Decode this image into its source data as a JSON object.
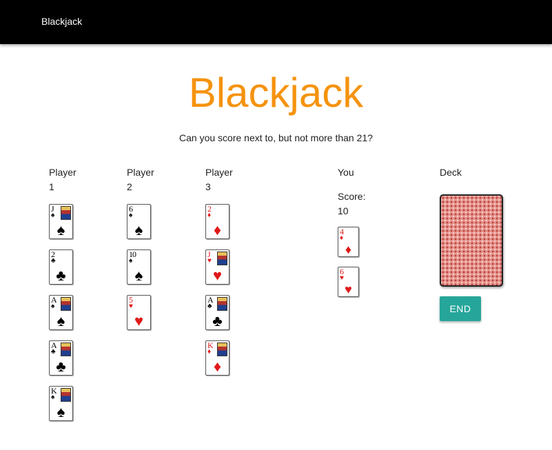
{
  "appbar": {
    "title": "Blackjack"
  },
  "header": {
    "title": "Blackjack",
    "subtitle": "Can you score next to, but not more than 21?"
  },
  "players": [
    {
      "label_line1": "Player",
      "label_line2": "1",
      "cards": [
        {
          "rank": "J",
          "suit": "♠",
          "color": "black",
          "face": true
        },
        {
          "rank": "2",
          "suit": "♣",
          "color": "black",
          "face": false
        },
        {
          "rank": "A",
          "suit": "♠",
          "color": "black",
          "face": true
        },
        {
          "rank": "A",
          "suit": "♣",
          "color": "black",
          "face": true
        },
        {
          "rank": "K",
          "suit": "♠",
          "color": "black",
          "face": true
        }
      ]
    },
    {
      "label_line1": "Player",
      "label_line2": "2",
      "cards": [
        {
          "rank": "6",
          "suit": "♠",
          "color": "black",
          "face": false
        },
        {
          "rank": "10",
          "suit": "♠",
          "color": "black",
          "face": false
        },
        {
          "rank": "5",
          "suit": "♥",
          "color": "red",
          "face": false
        }
      ]
    },
    {
      "label_line1": "Player",
      "label_line2": "3",
      "cards": [
        {
          "rank": "2",
          "suit": "♦",
          "color": "red",
          "face": false
        },
        {
          "rank": "J",
          "suit": "♥",
          "color": "red",
          "face": true
        },
        {
          "rank": "A",
          "suit": "♣",
          "color": "black",
          "face": true
        },
        {
          "rank": "K",
          "suit": "♦",
          "color": "red",
          "face": true
        }
      ]
    }
  ],
  "you": {
    "label": "You",
    "score_label": "Score:",
    "score_value": "10",
    "cards": [
      {
        "rank": "4",
        "suit": "♦",
        "color": "red",
        "face": false
      },
      {
        "rank": "6",
        "suit": "♥",
        "color": "red",
        "face": false
      }
    ]
  },
  "deck": {
    "label": "Deck",
    "end_label": "END"
  },
  "colors": {
    "accent": "#f5930f",
    "button": "#26a69a",
    "appbar": "#000000",
    "red_suit": "#e01818"
  },
  "icons": {
    "deck": "card-back-icon"
  }
}
